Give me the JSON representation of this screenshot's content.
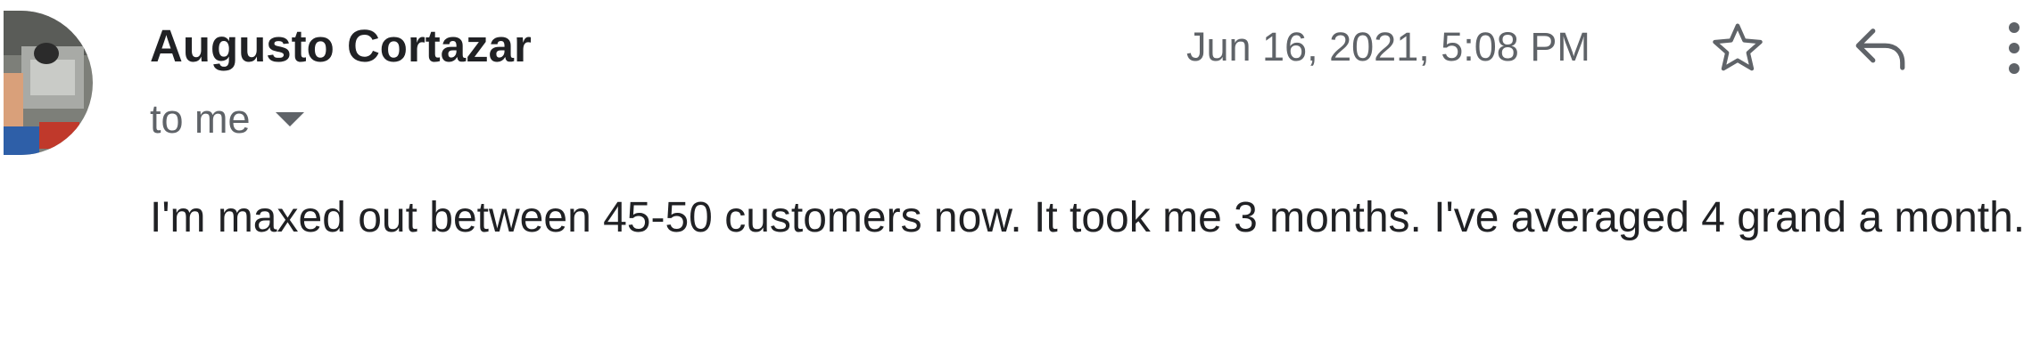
{
  "email": {
    "sender_name": "Augusto Cortazar",
    "recipient_label": "to me",
    "timestamp": "Jun 16, 2021, 5:08 PM",
    "body": "I'm maxed out between 45-50 customers now. It took me 3 months. I've averaged 4 grand a month."
  },
  "icons": {
    "avatar": "sender-avatar-photo",
    "recipient_dropdown": "caret-down-icon",
    "star": "star-outline-icon",
    "reply": "reply-icon",
    "more": "more-vertical-icon"
  },
  "colors": {
    "text_primary": "#202124",
    "text_secondary": "#5f6368"
  }
}
